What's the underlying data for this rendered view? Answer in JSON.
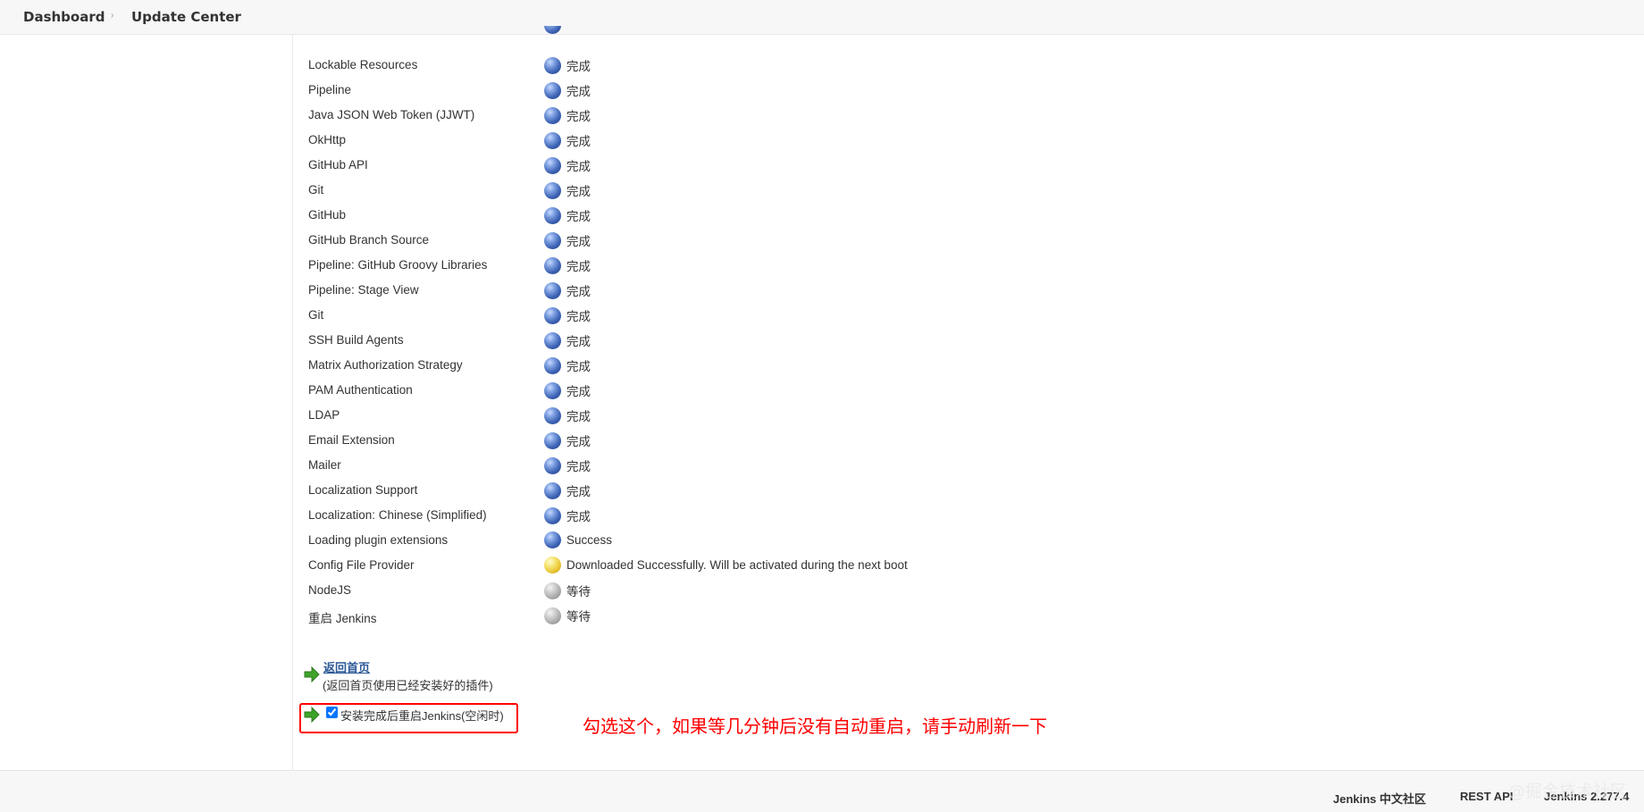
{
  "breadcrumb": {
    "dashboard": "Dashboard",
    "update_center": "Update Center"
  },
  "plugins": [
    {
      "name": "Lockable Resources",
      "status": "完成",
      "state": "blue"
    },
    {
      "name": "Pipeline",
      "status": "完成",
      "state": "blue"
    },
    {
      "name": "Java JSON Web Token (JJWT)",
      "status": "完成",
      "state": "blue"
    },
    {
      "name": "OkHttp",
      "status": "完成",
      "state": "blue"
    },
    {
      "name": "GitHub API",
      "status": "完成",
      "state": "blue"
    },
    {
      "name": "Git",
      "status": "完成",
      "state": "blue"
    },
    {
      "name": "GitHub",
      "status": "完成",
      "state": "blue"
    },
    {
      "name": "GitHub Branch Source",
      "status": "完成",
      "state": "blue"
    },
    {
      "name": "Pipeline: GitHub Groovy Libraries",
      "status": "完成",
      "state": "blue"
    },
    {
      "name": "Pipeline: Stage View",
      "status": "完成",
      "state": "blue"
    },
    {
      "name": "Git",
      "status": "完成",
      "state": "blue"
    },
    {
      "name": "SSH Build Agents",
      "status": "完成",
      "state": "blue"
    },
    {
      "name": "Matrix Authorization Strategy",
      "status": "完成",
      "state": "blue"
    },
    {
      "name": "PAM Authentication",
      "status": "完成",
      "state": "blue"
    },
    {
      "name": "LDAP",
      "status": "完成",
      "state": "blue"
    },
    {
      "name": "Email Extension",
      "status": "完成",
      "state": "blue"
    },
    {
      "name": "Mailer",
      "status": "完成",
      "state": "blue"
    },
    {
      "name": "Localization Support",
      "status": "完成",
      "state": "blue"
    },
    {
      "name": "Localization: Chinese (Simplified)",
      "status": "完成",
      "state": "blue"
    },
    {
      "name": "Loading plugin extensions",
      "status": "Success",
      "state": "blue"
    },
    {
      "name": "Config File Provider",
      "status": "Downloaded Successfully. Will be activated during the next boot",
      "state": "yellow"
    },
    {
      "name": "NodeJS",
      "status": "等待",
      "state": "grey"
    },
    {
      "name": "重启 Jenkins",
      "status": "等待",
      "state": "grey"
    }
  ],
  "actions": {
    "back_link": "返回首页",
    "back_note": "(返回首页使用已经安装好的插件)",
    "restart_label": "安装完成后重启Jenkins(空闲时)",
    "restart_checked": true
  },
  "annotation": "勾选这个，如果等几分钟后没有自动重启，请手动刷新一下",
  "footer": {
    "community": "Jenkins 中文社区",
    "rest_api": "REST API",
    "version": "Jenkins 2.277.4"
  },
  "watermark": "@掘金技术社区",
  "colors": {
    "blue_ball": "#3c62b4",
    "yellow_ball": "#e8c430",
    "grey_ball": "#a7a7a7",
    "highlight_red": "#ff0000",
    "link_blue": "#2b5797",
    "arrow_green": "#3fa32a"
  }
}
